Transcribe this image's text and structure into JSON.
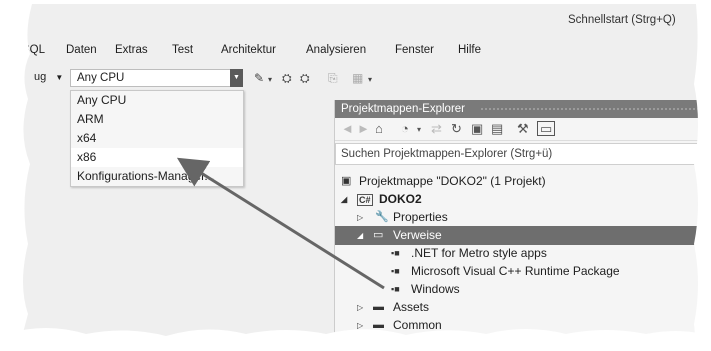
{
  "header": {
    "quick_launch": "Schnellstart (Strg+Q)"
  },
  "menu": [
    "SQL",
    "Daten",
    "Extras",
    "Test",
    "Architektur",
    "Analysieren",
    "Fenster",
    "Hilfe"
  ],
  "toolbar": {
    "left_combo_value": "ug",
    "platform_combo_value": "Any CPU"
  },
  "platform_dropdown": {
    "options": [
      "Any CPU",
      "ARM",
      "x64",
      "x86",
      "Konfigurations-Manager..."
    ],
    "highlighted": "x86"
  },
  "solution_explorer": {
    "title": "Projektmappen-Explorer",
    "search_placeholder": "Suchen Projektmappen-Explorer (Strg+ü)",
    "tree": {
      "solution": "Projektmappe \"DOKO2\" (1 Projekt)",
      "project": "DOKO2",
      "properties": "Properties",
      "references": "Verweise",
      "ref_items": [
        ".NET for Metro style apps",
        "Microsoft Visual C++ Runtime Package",
        "Windows"
      ],
      "assets": "Assets",
      "common": "Common"
    }
  },
  "colors": {
    "background": "#efefef",
    "panel_title": "#7a7a7a",
    "selection": "#6e6e6e",
    "arrow": "#666666"
  }
}
